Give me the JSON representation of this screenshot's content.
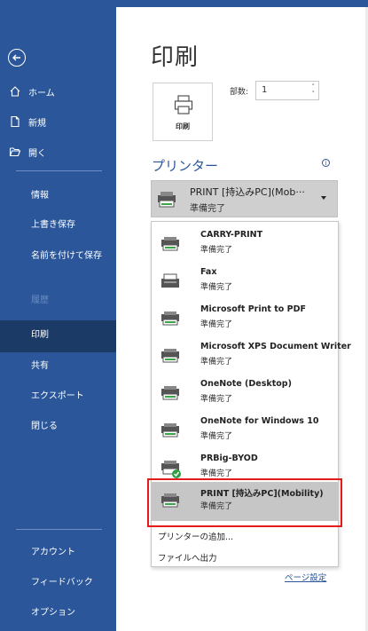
{
  "colors": {
    "sidebar": "#2b579a",
    "sidebar_active": "#1c3a66",
    "accent": "#2b579a",
    "highlight_outline": "#e51c1c"
  },
  "sidebar": {
    "back_icon": "back-arrow-icon",
    "home": {
      "label": "ホーム",
      "icon": "home-icon"
    },
    "new": {
      "label": "新規",
      "icon": "new-document-icon"
    },
    "open": {
      "label": "開く",
      "icon": "folder-open-icon"
    },
    "info": "情報",
    "save_overwrite": "上書き保存",
    "save_as": "名前を付けて保存",
    "history": "履歴",
    "print": "印刷",
    "share": "共有",
    "export": "エクスポート",
    "close": "閉じる",
    "account": "アカウント",
    "feedback": "フィードバック",
    "options": "オプション"
  },
  "main": {
    "title": "印刷",
    "print_button_label": "印刷",
    "copies_label": "部数:",
    "copies_value": "1",
    "printer_heading": "プリンター",
    "info_symbol": "i",
    "selected_printer": {
      "name": "PRINT [持込みPC](Mob···",
      "status": "準備完了"
    },
    "page_setup_link": "ページ設定"
  },
  "dropdown": {
    "items": [
      {
        "name": "CARRY-PRINT",
        "status": "準備完了",
        "icon": "printer-icon"
      },
      {
        "name": "Fax",
        "status": "準備完了",
        "icon": "fax-icon"
      },
      {
        "name": "Microsoft Print to PDF",
        "status": "準備完了",
        "icon": "printer-icon"
      },
      {
        "name": "Microsoft XPS Document Writer",
        "status": "準備完了",
        "icon": "printer-icon"
      },
      {
        "name": "OneNote (Desktop)",
        "status": "準備完了",
        "icon": "printer-icon"
      },
      {
        "name": "OneNote for Windows 10",
        "status": "準備完了",
        "icon": "printer-icon"
      },
      {
        "name": "PRBig-BYOD",
        "status": "準備完了",
        "icon": "printer-default-check-icon"
      },
      {
        "name": "PRINT [持込みPC](Mobility)",
        "status": "準備完了",
        "icon": "printer-icon"
      }
    ],
    "add_printer": "プリンターの追加...",
    "print_to_file": "ファイルへ出力"
  }
}
